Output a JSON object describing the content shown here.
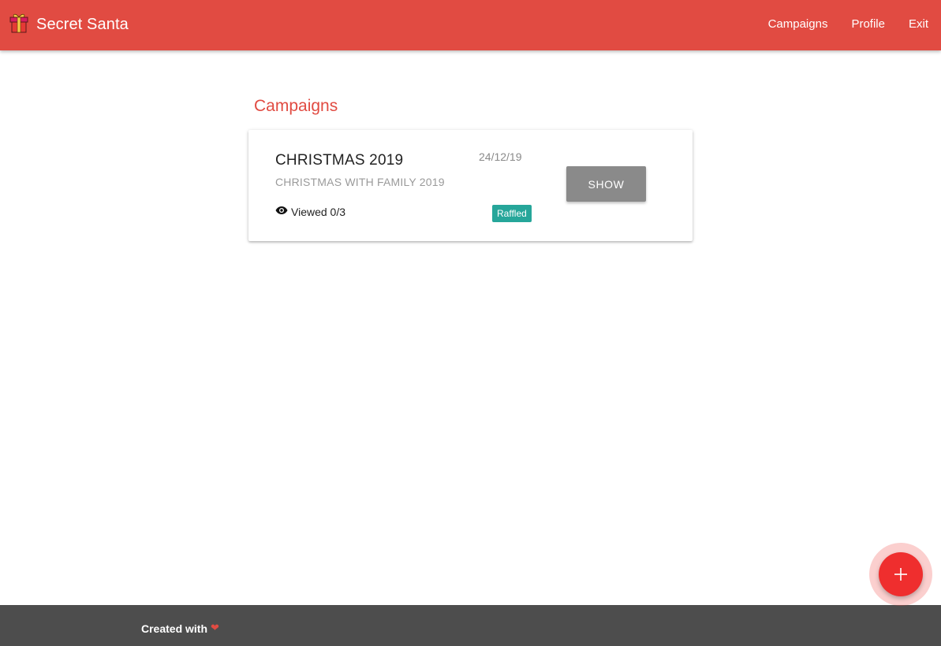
{
  "app": {
    "title": "Secret Santa",
    "brand_icon": "gift-icon",
    "accent_color": "#e14b42"
  },
  "nav": {
    "items": [
      {
        "label": "Campaigns"
      },
      {
        "label": "Profile"
      },
      {
        "label": "Exit"
      }
    ]
  },
  "main": {
    "section_title": "Campaigns",
    "campaigns": [
      {
        "title": "CHRISTMAS 2019",
        "subtitle": "CHRISTMAS WITH FAMILY 2019",
        "date": "24/12/19",
        "viewed_icon": "eye-icon",
        "viewed_text": "Viewed 0/3",
        "status_badge": "Raffled",
        "status_color": "#26a69a",
        "action_label": "SHOW"
      }
    ]
  },
  "fab": {
    "icon": "plus-icon",
    "color": "#ef2e2e"
  },
  "footer": {
    "credit_text": "Created with",
    "credit_icon": "heart-icon"
  }
}
